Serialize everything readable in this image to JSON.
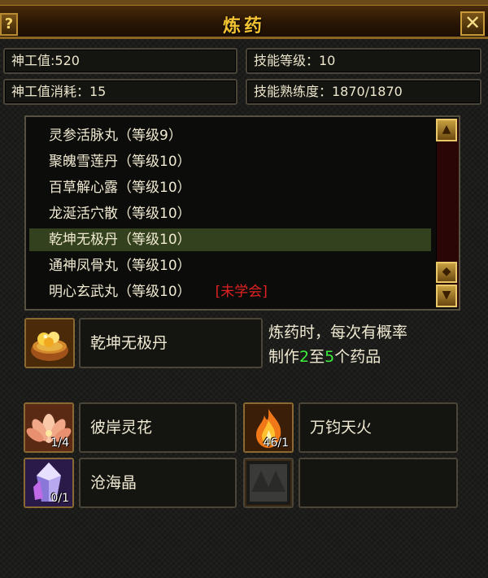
{
  "window": {
    "title": "炼药",
    "help_label": "?",
    "close_label": "✕"
  },
  "stats": {
    "shengong_value": "神工值:520",
    "skill_level": "技能等级：10",
    "shengong_cost": "神工值消耗：15",
    "skill_proficiency": "技能熟练度：1870/1870"
  },
  "recipes": {
    "items": [
      {
        "label": "灵参活脉丸（等级9）"
      },
      {
        "label": "聚魄雪莲丹（等级10）"
      },
      {
        "label": "百草解心露（等级10）"
      },
      {
        "label": "龙涎活穴散（等级10）"
      },
      {
        "label": "乾坤无极丹（等级10）"
      },
      {
        "label": "通神凤骨丸（等级10）"
      },
      {
        "label": "明心玄武丸（等级10）"
      }
    ],
    "selected_index": 4,
    "unlearned_label": "[未学会]",
    "scroll_up_icon": "arrow-up-icon",
    "scroll_down_icon": "arrow-down-icon"
  },
  "product": {
    "name": "乾坤无极丹",
    "icon": "pill-bowl-icon",
    "desc_line1": "炼药时，每次有概率",
    "desc_prefix": "制作",
    "desc_num1": "2",
    "desc_mid": "至",
    "desc_num2": "5",
    "desc_suffix": "个药品"
  },
  "materials": [
    {
      "name": "彼岸灵花",
      "count": "1/4",
      "icon": "lotus-flower-icon"
    },
    {
      "name": "万钧天火",
      "count": "46/1",
      "icon": "fire-icon"
    },
    {
      "name": "沧海晶",
      "count": "0/1",
      "icon": "crystal-icon"
    },
    {
      "name": "",
      "count": "",
      "icon": "empty-slot-icon"
    }
  ],
  "colors": {
    "title": "#f2c232",
    "unlearned": "#e02222",
    "highlight_number": "#3cf03c",
    "selected_row": "#34411e"
  }
}
